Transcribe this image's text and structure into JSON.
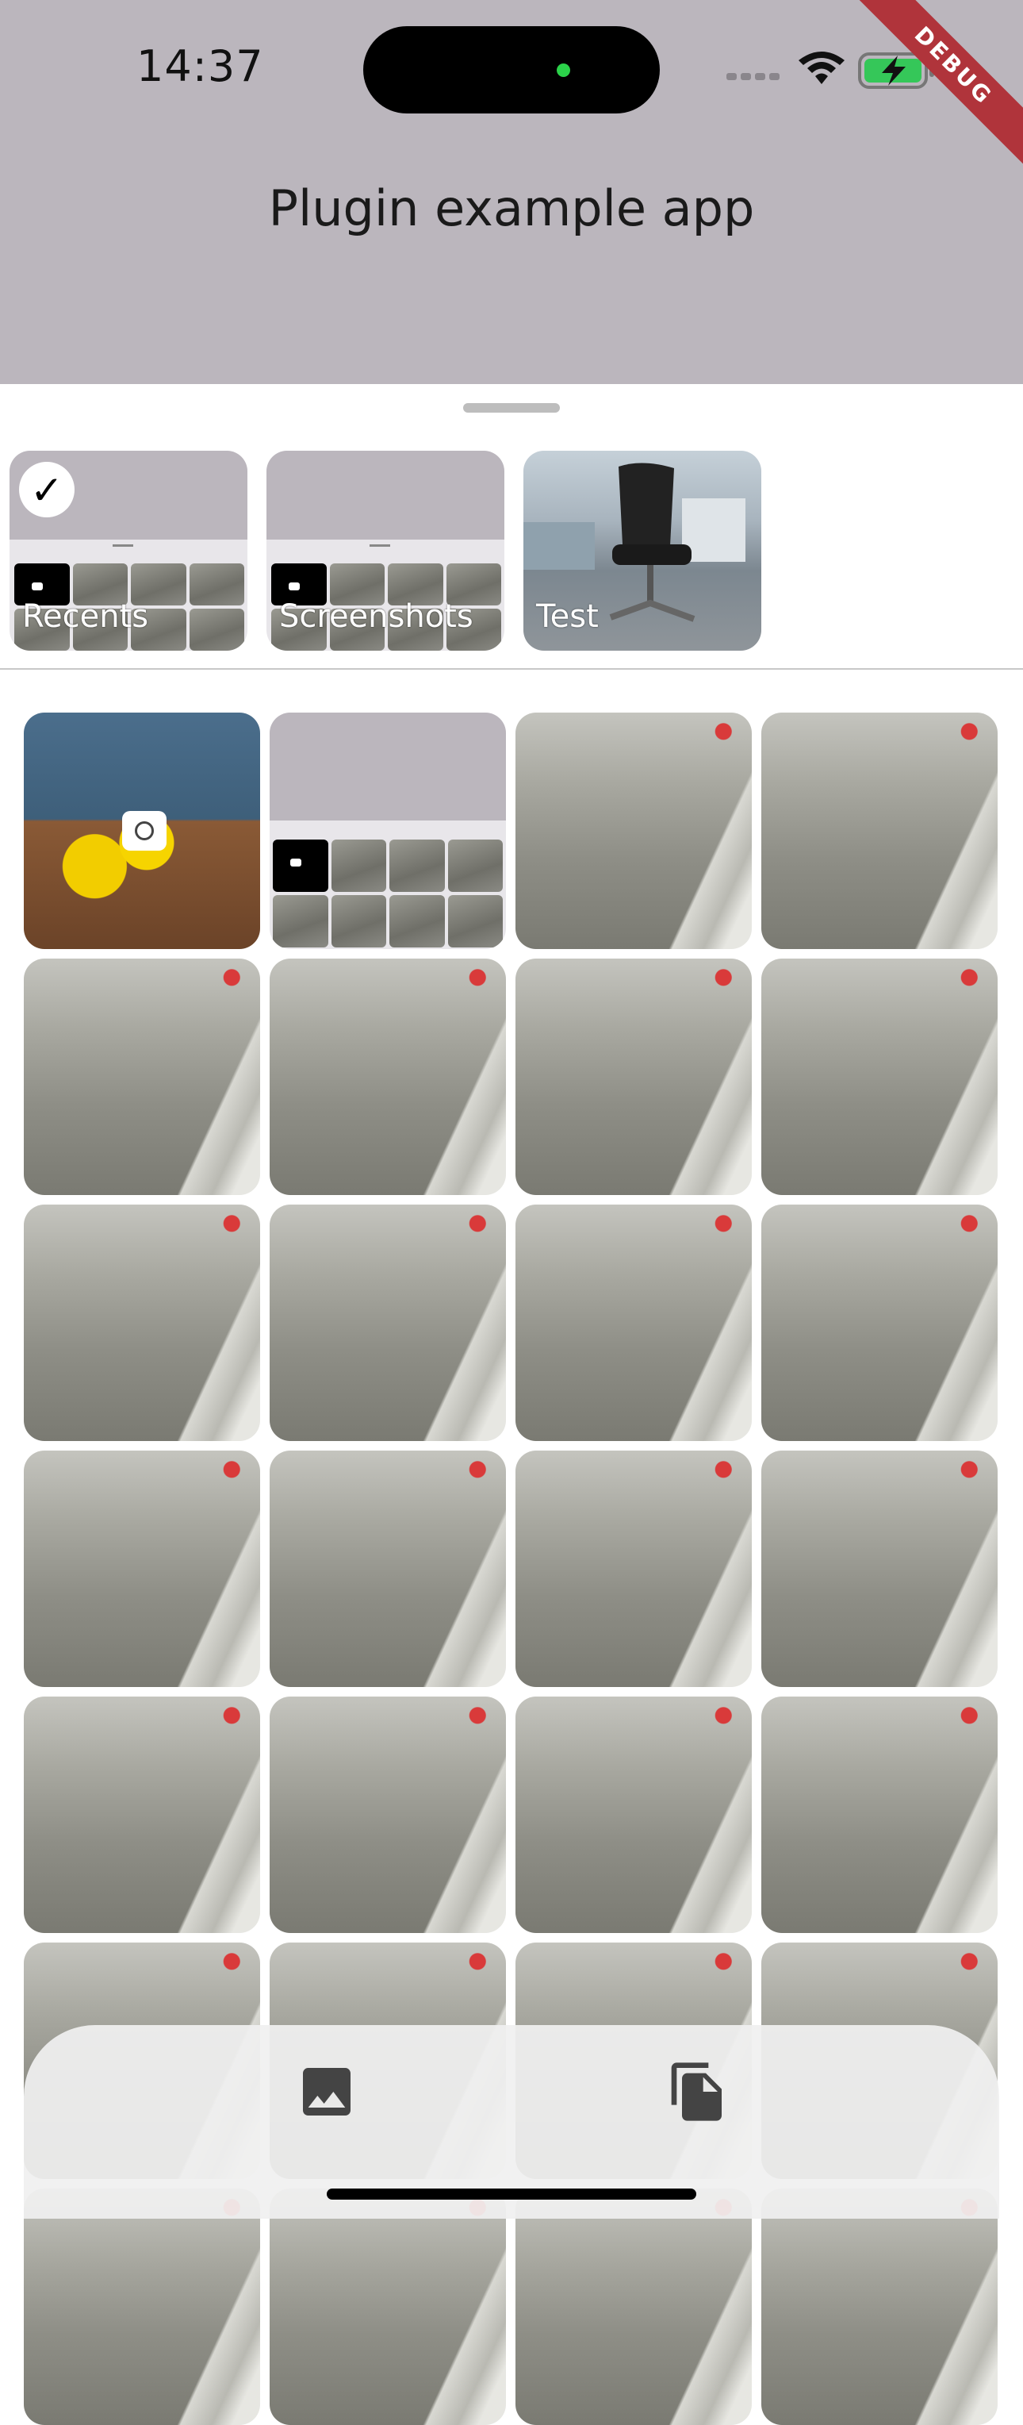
{
  "status_bar": {
    "time": "14:37",
    "debug_banner": "DEBUG"
  },
  "app_bar": {
    "title": "Plugin example app",
    "background": "#bbb6bd"
  },
  "albums": [
    {
      "label": "Recents",
      "selected": true
    },
    {
      "label": "Screenshots",
      "selected": false
    },
    {
      "label": "Test",
      "selected": false
    }
  ],
  "photo_grid": {
    "columns": 4,
    "visible_rows": 6
  },
  "bottom_bar": {
    "gallery_icon": "image-icon",
    "files_icon": "file-copy-icon"
  }
}
